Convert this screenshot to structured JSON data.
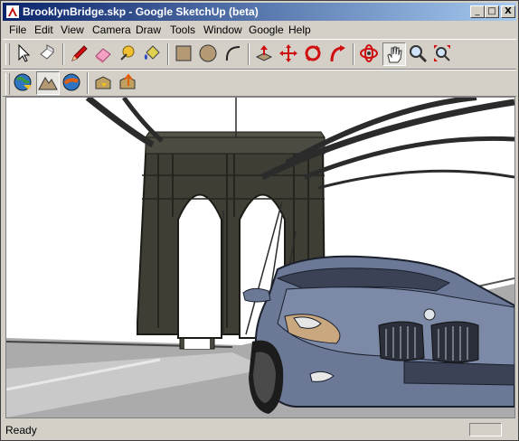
{
  "window": {
    "title": "BrooklynBridge.skp - Google SketchUp (beta)",
    "controls": {
      "minimize": "_",
      "maximize": "□",
      "close": "X"
    }
  },
  "menu": {
    "items": [
      "File",
      "Edit",
      "View",
      "Camera",
      "Draw",
      "Tools",
      "Window",
      "Google",
      "Help"
    ]
  },
  "toolbar_main": {
    "tools": [
      "select-tool",
      "eraser-tool",
      "pencil-tool",
      "paint-eraser-tool",
      "tape-measure-tool",
      "paint-bucket-tool",
      "rectangle-tool",
      "circle-tool",
      "arc-tool",
      "push-pull-tool",
      "move-tool",
      "rotate-tool",
      "follow-me-tool",
      "orbit-tool",
      "pan-tool",
      "zoom-tool",
      "zoom-extents-tool"
    ],
    "active": "pan-tool"
  },
  "toolbar_google": {
    "tools": [
      "get-current-view-tool",
      "toggle-terrain-tool",
      "place-model-tool",
      "get-models-tool",
      "share-model-tool"
    ],
    "active": "toggle-terrain-tool"
  },
  "status": {
    "text": "Ready"
  },
  "colors": {
    "title_start": "#0a246a",
    "title_end": "#a6caf0",
    "chrome": "#d4d0c8",
    "bridge": "#3f3e35",
    "car": "#6b7896"
  }
}
